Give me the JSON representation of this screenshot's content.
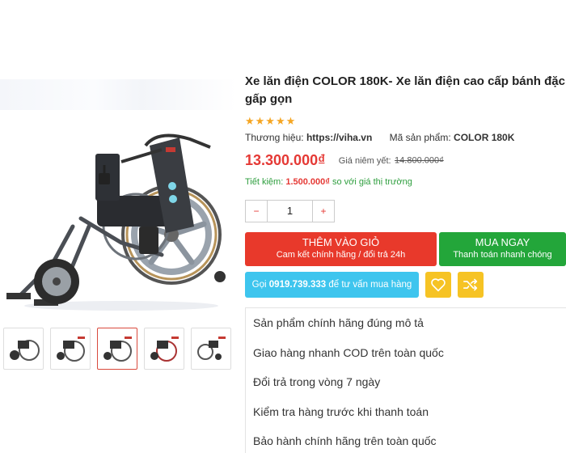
{
  "product": {
    "title": "Xe lăn điện COLOR 180K- Xe lăn điện cao cấp bánh đặc gấp gọn",
    "stars": "★★★★★",
    "brand_label": "Thương hiệu:",
    "brand_value": "https://viha.vn",
    "sku_label": "Mã sản phẩm:",
    "sku_value": "COLOR 180K",
    "price": "13.300.000₫",
    "list_price_label": "Giá niêm yết:",
    "list_price": "14.800.000₫",
    "savings_prefix": "Tiết kiệm:",
    "savings_value": "1.500.000₫",
    "savings_suffix": "so với giá thị trường"
  },
  "quantity": {
    "minus": "−",
    "value": "1",
    "plus": "+"
  },
  "actions": {
    "cart_label": "THÊM VÀO GIỎ",
    "cart_sub": "Cam kết chính hãng / đổi trả 24h",
    "buy_label": "MUA NGAY",
    "buy_sub": "Thanh toán nhanh chóng",
    "call_prefix": "Gọi",
    "call_phone": "0919.739.333",
    "call_suffix": "để tư vấn mua hàng"
  },
  "features": [
    "Sản phẩm chính hãng đúng mô tả",
    "Giao hàng nhanh COD trên toàn quốc",
    "Đổi trả trong vòng 7 ngày",
    "Kiểm tra hàng trước khi thanh toán",
    "Bảo hành chính hãng trên toàn quốc"
  ],
  "icons": {
    "wishlist": "heart-icon",
    "compare": "shuffle-icon"
  },
  "colors": {
    "price_red": "#e53935",
    "cart_red": "#e8392b",
    "buy_green": "#23a63a",
    "call_blue": "#3ec5ee",
    "icon_yellow": "#f6c324",
    "star_gold": "#f5a623"
  }
}
